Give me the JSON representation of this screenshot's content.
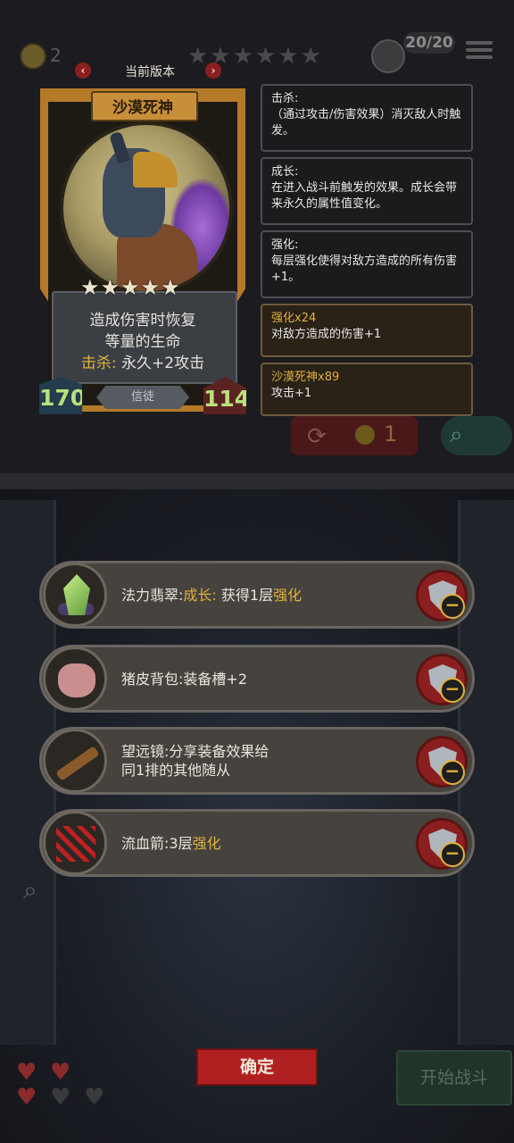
{
  "topbar": {
    "coins": "2",
    "stars": "★★★★★★",
    "turn": "20/20"
  },
  "version": {
    "label": "当前版本",
    "prev": "‹",
    "next": "›"
  },
  "card": {
    "name": "沙漠死神",
    "stars": "★★★★★",
    "desc_line1": "造成伤害时恢复",
    "desc_line2": "等量的生命",
    "keyword": "击杀:",
    "keyword_effect": "永久+2攻击",
    "attack": "170",
    "health": "114",
    "tribe": "信徒"
  },
  "panels": [
    {
      "title": "击杀:",
      "body": "（通过攻击/伤害效果）消灭敌人时触发。"
    },
    {
      "title": "成长:",
      "body": "在进入战斗前触发的效果。成长会带来永久的属性值变化。"
    },
    {
      "title": "强化:",
      "body": "每层强化使得对敌方造成的所有伤害+1。"
    },
    {
      "title": "强化x24",
      "body": "对敌方造成的伤害+1"
    },
    {
      "title": "沙漠死神x89",
      "body": "攻击+1"
    }
  ],
  "reroll": {
    "cost": "1"
  },
  "items": [
    {
      "name": "法力翡翠:",
      "effect_keyword": "成长:",
      "effect": "获得1层",
      "effect_tail": "强化"
    },
    {
      "name": "猪皮背包:",
      "effect": "装备槽+2"
    },
    {
      "name": "望远镜:",
      "effect": "分享装备效果给",
      "effect_line2": "同1排的其他随从"
    },
    {
      "name": "流血箭:",
      "effect": "3层",
      "effect_tail": "强化"
    }
  ],
  "bottom": {
    "confirm": "确定",
    "start": "开始战斗"
  },
  "colors": {
    "keyword_gold": "#e0b23e",
    "confirm_red": "#b12020",
    "card_frame": "#b57a28"
  }
}
